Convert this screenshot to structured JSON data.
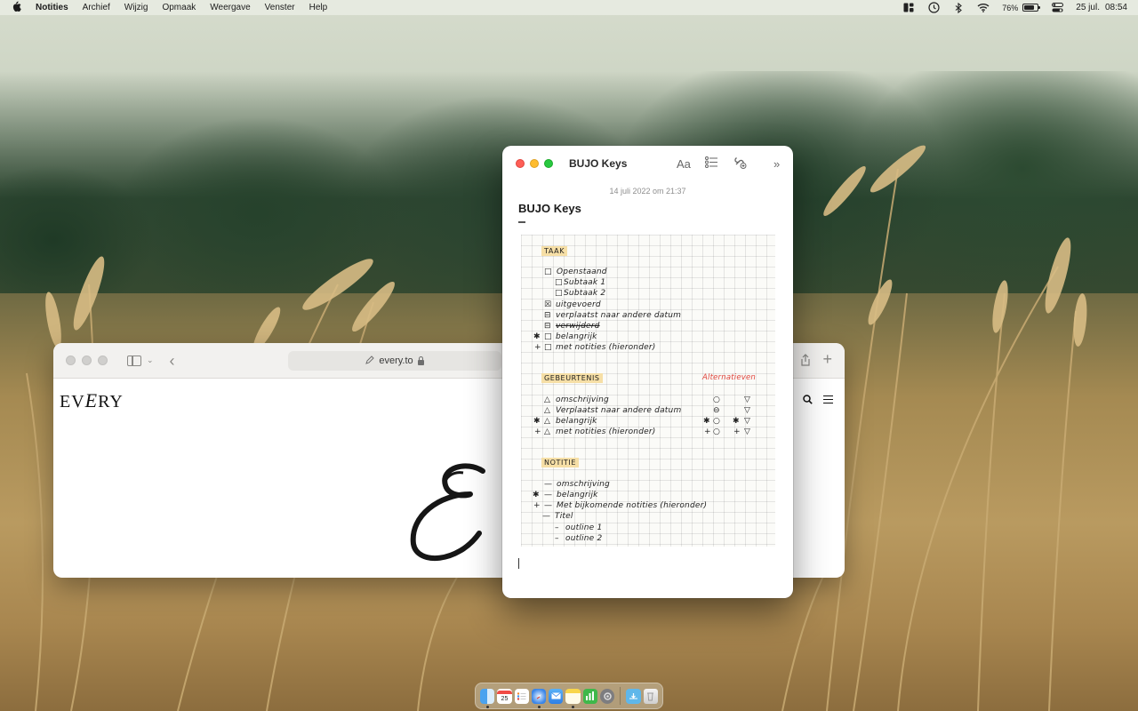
{
  "menubar": {
    "app_name": "Notities",
    "items": [
      "Archief",
      "Wijzig",
      "Opmaak",
      "Weergave",
      "Venster",
      "Help"
    ],
    "battery_percent": "76%",
    "battery_level": 0.76,
    "date": "25 jul.",
    "time": "08:54"
  },
  "safari": {
    "url": "every.to",
    "logo_prefix": "EV",
    "logo_script": "E",
    "logo_suffix": "RY"
  },
  "notes": {
    "window_title": "BUJO Keys",
    "format_button": "Aa",
    "date": "14 juli 2022 om 21:37",
    "title": "BUJO Keys",
    "sheet": {
      "taak_header": "TAAK",
      "taak_items": [
        "Openstaand",
        "Subtaak 1",
        "Subtaak 2",
        "uitgevoerd",
        "verplaatst naar andere datum",
        "verwijderd",
        "belangrijk",
        "met notities (hieronder)"
      ],
      "gebeurtenis_header": "GEBEURTENIS",
      "alternatieven_label": "Alternatieven",
      "gebeurtenis_items": [
        "omschrijving",
        "Verplaatst naar andere datum",
        "belangrijk",
        "met notities (hieronder)"
      ],
      "notitie_header": "NOTITIE",
      "notitie_items": [
        "omschrijving",
        "belangrijk",
        "Met bijkomende notities (hieronder)",
        "Titel",
        "outline 1",
        "outline 2"
      ]
    }
  },
  "dock": {
    "calendar_day": "25",
    "apps": [
      "finder-icon",
      "calendar-icon",
      "reminders-icon",
      "safari-icon",
      "mail-icon",
      "notes-icon",
      "numbers-icon",
      "system-settings-icon",
      "downloads-folder-icon",
      "trash-icon"
    ]
  }
}
